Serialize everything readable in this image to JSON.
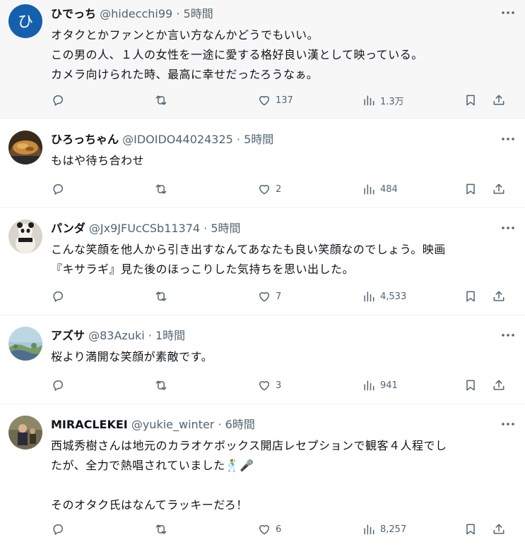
{
  "posts": [
    {
      "name": "ひでっち",
      "handle": "@hidecchi99",
      "sep": "·",
      "time": "5時間",
      "avatar_letter": "ひ",
      "text": "オタクとかファンとか言い方なんかどうでもいい。\nこの男の人、１人の女性を一途に愛する格好良い漢として映っている。\nカメラ向けられた時、最高に幸せだったろうなぁ。",
      "replies": "",
      "retweets": "",
      "likes": "137",
      "views": "1.3万"
    },
    {
      "name": "ひろっちゃん",
      "handle": "@IDOIDO44024325",
      "sep": "·",
      "time": "5時間",
      "text": "もはや待ち合わせ",
      "replies": "",
      "retweets": "",
      "likes": "2",
      "views": "484"
    },
    {
      "name": "パンダ",
      "handle": "@Jx9JFUcCSb11374",
      "sep": "·",
      "time": "5時間",
      "text": "こんな笑顔を他人から引き出すなんてあなたも良い笑顔なのでしょう。映画\n『キサラギ』見た後のほっこりした気持ちを思い出した。",
      "replies": "",
      "retweets": "",
      "likes": "7",
      "views": "4,533"
    },
    {
      "name": "アズサ",
      "handle": "@83Azuki",
      "sep": "·",
      "time": "1時間",
      "text": "桜より満開な笑顔が素敵です。",
      "replies": "",
      "retweets": "",
      "likes": "3",
      "views": "941"
    },
    {
      "name": "MIRACLEKEI",
      "handle": "@yukie_winter",
      "sep": "·",
      "time": "6時間",
      "text": "西城秀樹さんは地元のカラオケボックス開店レセプションで観客４人程でし\nたが、全力で熱唱されていました🕺🎤\n\nそのオタク氏はなんてラッキーだろ！",
      "replies": "",
      "retweets": "",
      "likes": "6",
      "views": "8,257"
    }
  ],
  "icons": {
    "more": "more-horizontal-icon",
    "reply": "reply-icon",
    "retweet": "retweet-icon",
    "like": "heart-icon",
    "views": "views-chart-icon",
    "bookmark": "bookmark-icon",
    "share": "share-icon"
  },
  "colors": {
    "text": "#0f1419",
    "secondary": "#536471",
    "avatar_blue": "#1560ac",
    "highlight_bg": "#f7f7f7"
  }
}
